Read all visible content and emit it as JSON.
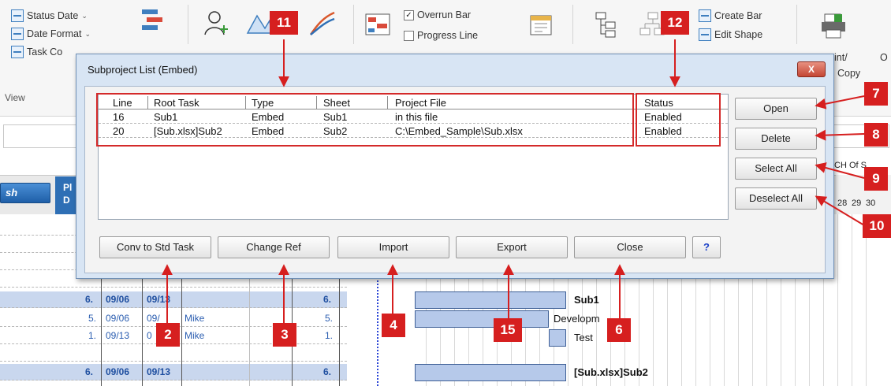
{
  "ribbon": {
    "status_date": "Status Date",
    "date_format": "Date Format",
    "task_co": "Task Co",
    "view_label": "View",
    "overrun_bar": "Overrun Bar",
    "overrun_checked": true,
    "progress_line": "Progress Line",
    "progress_checked": false,
    "create_bar": "Create Bar",
    "edit_shape": "Edit Shape",
    "print_copy_a": "int/",
    "print_copy_b": "Copy",
    "o_label": "O"
  },
  "sheet": {
    "push_button": "sh",
    "header_blue_a": "Pl",
    "header_blue_b": "D",
    "date_top": "CH Of S",
    "date_days": [
      "28",
      "29",
      "30"
    ],
    "date_weekdays": [
      "F",
      "S"
    ],
    "rows": [
      {
        "num": "6.",
        "start": "09/06",
        "end": "09/13",
        "who": "",
        "dur": "6.",
        "summary": true
      },
      {
        "num": "5.",
        "start": "09/06",
        "end": "09/",
        "who": "Mike",
        "dur": "5.",
        "summary": false
      },
      {
        "num": "1.",
        "start": "09/13",
        "end": "0",
        "who": "Mike",
        "dur": "1.",
        "summary": false
      },
      {
        "num": "6.",
        "start": "09/06",
        "end": "09/13",
        "who": "",
        "dur": "6.",
        "summary": true
      }
    ],
    "gantt_labels": [
      "Sub1",
      "Developm",
      "Test",
      "[Sub.xlsx]Sub2"
    ]
  },
  "dialog": {
    "title": "Subproject List (Embed)",
    "close_label": "X",
    "columns": [
      "Line",
      "Root Task",
      "Type",
      "Sheet",
      "Project File",
      "Status"
    ],
    "rows": [
      [
        "16",
        "Sub1",
        "Embed",
        "Sub1",
        "in this file",
        "Enabled"
      ],
      [
        "20",
        "[Sub.xlsx]Sub2",
        "Embed",
        "Sub2",
        "C:\\Embed_Sample\\Sub.xlsx",
        "Enabled"
      ]
    ],
    "side_buttons": {
      "open": "Open",
      "delete": "Delete",
      "select_all": "Select All",
      "deselect_all": "Deselect All"
    },
    "bottom_buttons": {
      "conv": "Conv to Std Task",
      "change_ref": "Change Ref",
      "import": "Import",
      "export": "Export",
      "close": "Close",
      "help": "?"
    }
  },
  "callouts": {
    "c2": "2",
    "c3": "3",
    "c4": "4",
    "c6": "6",
    "c7": "7",
    "c8": "8",
    "c9": "9",
    "c10": "10",
    "c11": "11",
    "c12": "12",
    "c15": "15"
  },
  "colors": {
    "callout": "#d61f1f",
    "dialog_bg": "#d8e5f4",
    "summary_row": "#c9d7ee",
    "bar_fill": "#b6c9ea",
    "today_line": "#2b45d6"
  }
}
